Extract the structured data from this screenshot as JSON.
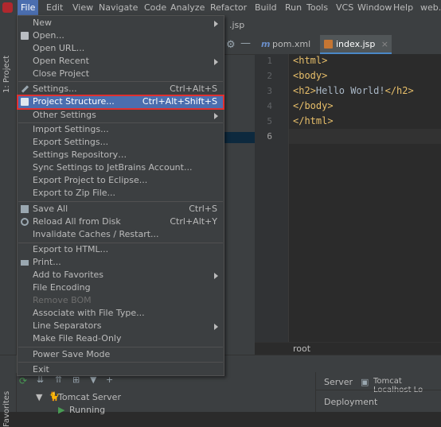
{
  "menubar": {
    "items": [
      "File",
      "Edit",
      "View",
      "Navigate",
      "Code",
      "Analyze",
      "Refactor",
      "Build",
      "Run",
      "Tools",
      "VCS",
      "Window",
      "Help",
      "web..."
    ]
  },
  "left_strip": {
    "project_label": "1: Project",
    "favorites_label": "Favorites"
  },
  "editor": {
    "top_file": ".jsp",
    "tabs": [
      {
        "label": "pom.xml",
        "icon": "maven-icon"
      },
      {
        "label": "index.jsp",
        "icon": "jsp-icon",
        "active": true
      }
    ],
    "line_numbers": [
      "1",
      "2",
      "3",
      "4",
      "5",
      "6"
    ],
    "lines": [
      {
        "tag1": "<html>",
        "text": "",
        "tag2": ""
      },
      {
        "tag1": "<body>",
        "text": "",
        "tag2": ""
      },
      {
        "tag1": "<h2>",
        "text": "Hello World!",
        "tag2": "</h2>"
      },
      {
        "tag1": "</body>",
        "text": "",
        "tag2": ""
      },
      {
        "tag1": "</html>",
        "text": "",
        "tag2": ""
      },
      {
        "tag1": "",
        "text": "",
        "tag2": ""
      }
    ],
    "breadcrumb": "root"
  },
  "bottom": {
    "server_tab": "Server",
    "tomcat_tab": "Tomcat Localhost Lo",
    "deployment_label": "Deployment",
    "tree_root": "Tomcat Server",
    "tree_child": "Running"
  },
  "file_menu": {
    "items": [
      {
        "label": "New",
        "submenu": true
      },
      {
        "label": "Open...",
        "icon": "folder-icon"
      },
      {
        "label": "Open URL..."
      },
      {
        "label": "Open Recent",
        "submenu": true
      },
      {
        "label": "Close Project"
      },
      {
        "label": "Settings...",
        "shortcut": "Ctrl+Alt+S",
        "icon": "wrench-icon"
      },
      {
        "label": "Project Structure...",
        "shortcut": "Ctrl+Alt+Shift+S",
        "icon": "project-structure-icon",
        "selected": true
      },
      {
        "label": "Other Settings",
        "submenu": true
      },
      {
        "label": "Import Settings..."
      },
      {
        "label": "Export Settings..."
      },
      {
        "label": "Settings Repository…"
      },
      {
        "label": "Sync Settings to JetBrains Account..."
      },
      {
        "label": "Export Project to Eclipse..."
      },
      {
        "label": "Export to Zip File..."
      },
      {
        "label": "Save All",
        "shortcut": "Ctrl+S",
        "icon": "save-icon"
      },
      {
        "label": "Reload All from Disk",
        "shortcut": "Ctrl+Alt+Y",
        "icon": "reload-icon"
      },
      {
        "label": "Invalidate Caches / Restart..."
      },
      {
        "label": "Export to HTML..."
      },
      {
        "label": "Print...",
        "icon": "print-icon"
      },
      {
        "label": "Add to Favorites",
        "submenu": true
      },
      {
        "label": "File Encoding"
      },
      {
        "label": "Remove BOM",
        "disabled": true
      },
      {
        "label": "Associate with File Type..."
      },
      {
        "label": "Line Separators",
        "submenu": true
      },
      {
        "label": "Make File Read-Only"
      },
      {
        "label": "Power Save Mode"
      },
      {
        "label": "Exit"
      }
    ]
  },
  "colors": {
    "highlight": "#4b6eaf",
    "annotation_box": "#e03030",
    "tag": "#e8bf6a"
  }
}
